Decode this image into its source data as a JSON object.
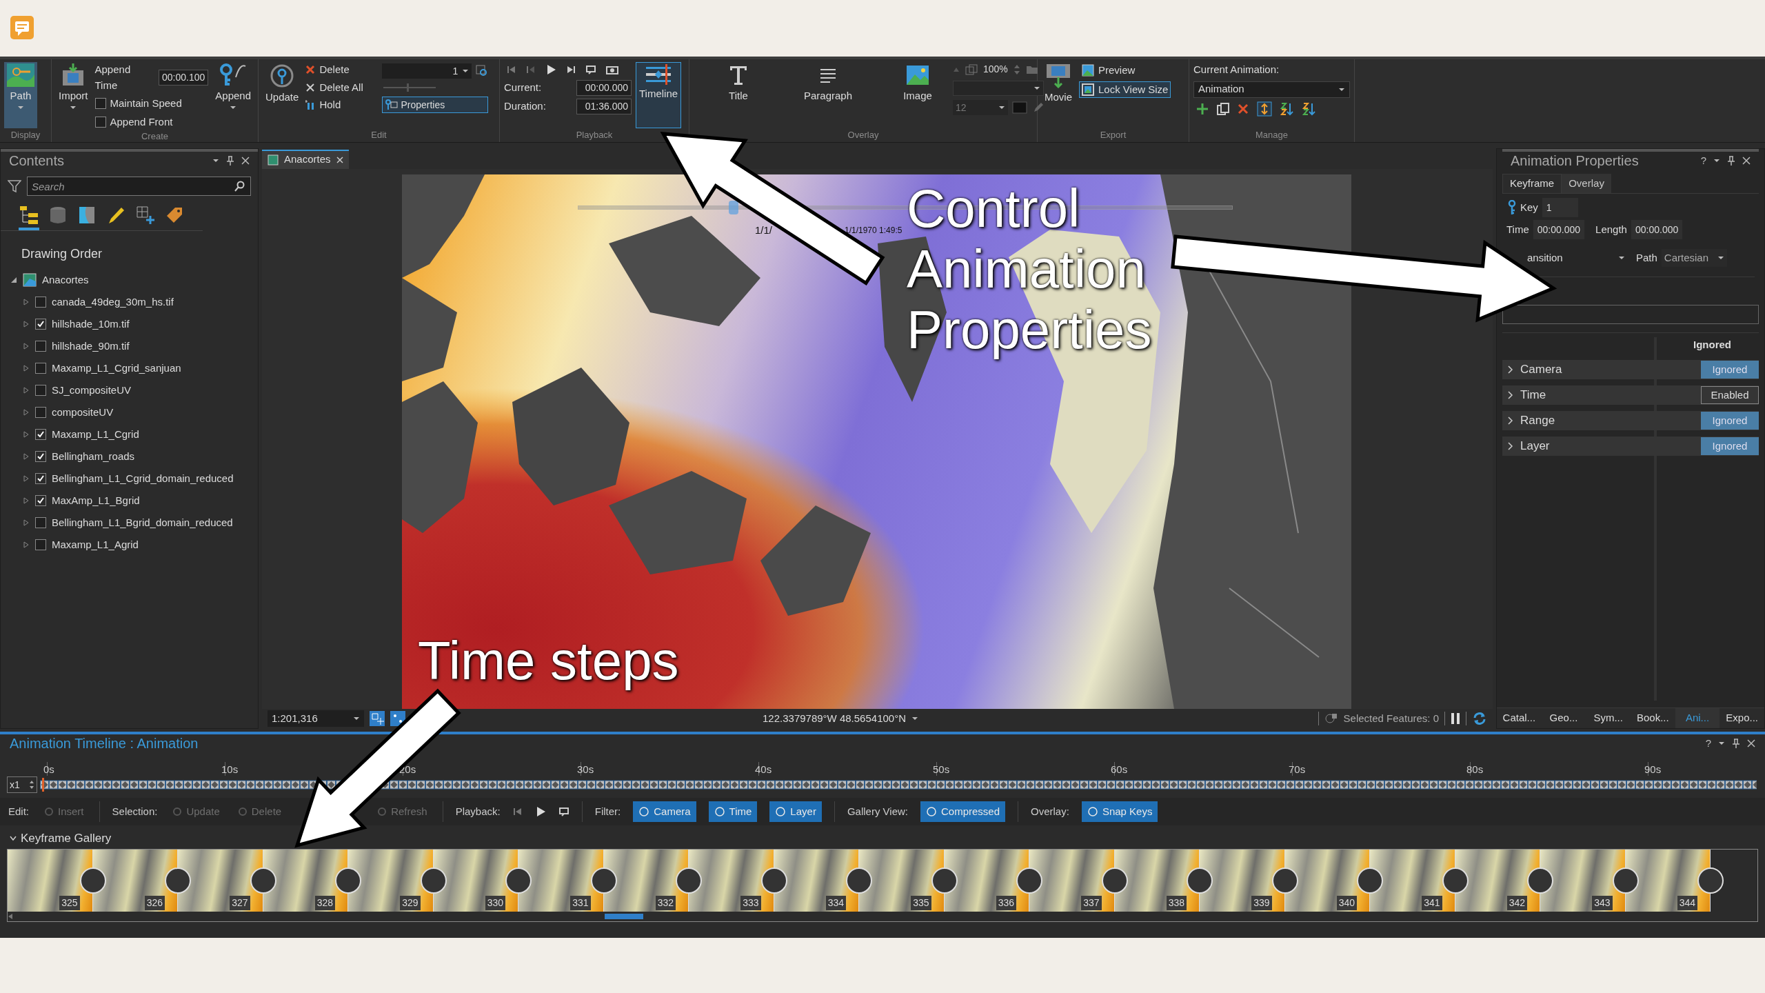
{
  "ribbon": {
    "display": {
      "label": "Display",
      "path_button": "Path"
    },
    "create": {
      "label": "Create",
      "import_button": "Import",
      "append_time_label": "Append Time",
      "append_time_value": "00:00.100",
      "append_button": "Append",
      "options": [
        {
          "label": "Maintain Speed",
          "checked": false
        },
        {
          "label": "Append Front",
          "checked": false
        }
      ]
    },
    "edit": {
      "label": "Edit",
      "update_button": "Update",
      "commands": [
        {
          "kind": "delete",
          "label": "Delete"
        },
        {
          "kind": "delete-all",
          "label": "Delete All"
        },
        {
          "kind": "hold",
          "label": "Hold"
        }
      ],
      "key_dropdown": "1",
      "properties_button": {
        "label": "Properties",
        "selected": true
      }
    },
    "playback": {
      "label": "Playback",
      "current_label": "Current:",
      "current_value": "00:00.000",
      "duration_label": "Duration:",
      "duration_value": "01:36.000",
      "timeline_button": {
        "label": "Timeline",
        "selected": true
      }
    },
    "overlay": {
      "label": "Overlay",
      "buttons": [
        {
          "kind": "title",
          "label": "Title"
        },
        {
          "kind": "paragraph",
          "label": "Paragraph"
        },
        {
          "kind": "image",
          "label": "Image"
        }
      ],
      "scale": "100%",
      "font_size": "12"
    },
    "export": {
      "label": "Export",
      "movie_button": "Movie",
      "options": [
        {
          "kind": "preview",
          "label": "Preview",
          "selected": false
        },
        {
          "kind": "lock",
          "label": "Lock View Size",
          "selected": true
        }
      ]
    },
    "manage": {
      "label": "Manage",
      "current_animation_label": "Current Animation:",
      "current_animation": "Animation"
    }
  },
  "contents": {
    "title": "Contents",
    "search_placeholder": "Search",
    "view_tabs": [
      {
        "kind": "drawing-order",
        "selected": true
      },
      {
        "kind": "data-source",
        "selected": false
      },
      {
        "kind": "selection",
        "selected": false
      },
      {
        "kind": "editing",
        "selected": false
      },
      {
        "kind": "snapping",
        "selected": false
      },
      {
        "kind": "labeling",
        "selected": false
      }
    ],
    "heading": "Drawing Order",
    "map": {
      "name": "Anacortes",
      "expanded": true,
      "children": [
        {
          "name": "canada_49deg_30m_hs.tif",
          "checked": false
        },
        {
          "name": "hillshade_10m.tif",
          "checked": true
        },
        {
          "name": "hillshade_90m.tif",
          "checked": false
        },
        {
          "name": "Maxamp_L1_Cgrid_sanjuan",
          "checked": false
        },
        {
          "name": "SJ_compositeUV",
          "checked": false
        },
        {
          "name": "compositeUV",
          "checked": false
        },
        {
          "name": "Maxamp_L1_Cgrid",
          "checked": true
        },
        {
          "name": "Bellingham_roads",
          "checked": true
        },
        {
          "name": "Bellingham_L1_Cgrid_domain_reduced",
          "checked": true
        },
        {
          "name": "MaxAmp_L1_Bgrid",
          "checked": true
        },
        {
          "name": "Bellingham_L1_Bgrid_domain_reduced",
          "checked": false
        },
        {
          "name": "Maxamp_L1_Agrid",
          "checked": false
        }
      ]
    }
  },
  "map_view": {
    "tab": "Anacortes",
    "time_slider": {
      "level": 0.23
    },
    "time_labels": [
      "1/1/",
      "1/1/1970 1:49:5"
    ],
    "scale": "1:201,316",
    "coordinates": "122.3379789°W 48.5654100°N",
    "selected_features": "Selected Features: 0"
  },
  "animation_properties": {
    "title": "Animation Properties",
    "help_button": "?",
    "tabs": [
      {
        "label": "Keyframe",
        "selected": true
      },
      {
        "label": "Overlay",
        "selected": false
      }
    ],
    "key_label": "Key",
    "key_value": "1",
    "time_label": "Time",
    "time_value": "00:00.000",
    "length_label": "Length",
    "length_value": "00:00.000",
    "transition_label": "ansition",
    "path_label": "Path",
    "path_value": "Cartesian",
    "column_header": "Ignored",
    "rows": [
      {
        "name": "Camera",
        "status": "Ignored",
        "highlighted": true
      },
      {
        "name": "Time",
        "status": "Enabled",
        "highlighted": false
      },
      {
        "name": "Range",
        "status": "Ignored",
        "highlighted": true
      },
      {
        "name": "Layer",
        "status": "Ignored",
        "highlighted": true
      }
    ]
  },
  "dock_tabs": [
    {
      "label": "Catal...",
      "selected": false
    },
    {
      "label": "Geo...",
      "selected": false
    },
    {
      "label": "Sym...",
      "selected": false
    },
    {
      "label": "Book...",
      "selected": false
    },
    {
      "label": "Ani...",
      "selected": true
    },
    {
      "label": "Expo...",
      "selected": false
    }
  ],
  "timeline": {
    "title": "Animation Timeline : Animation",
    "help_button": "?",
    "speed": "x1",
    "ticks": [
      "0s",
      "10s",
      "20s",
      "30s",
      "40s",
      "50s",
      "60s",
      "70s",
      "80s",
      "90s"
    ],
    "toolbar": [
      {
        "kind": "label",
        "text": "Edit:"
      },
      {
        "kind": "command",
        "text": "Insert",
        "disabled": true
      },
      {
        "kind": "separator"
      },
      {
        "kind": "label",
        "text": "Selection:"
      },
      {
        "kind": "command",
        "text": "Update",
        "disabled": true
      },
      {
        "kind": "command",
        "text": "Delete",
        "disabled": true
      },
      {
        "kind": "gap"
      },
      {
        "kind": "command",
        "text": "Refresh",
        "disabled": true
      },
      {
        "kind": "separator"
      },
      {
        "kind": "label",
        "text": "Playback:"
      },
      {
        "kind": "playback"
      },
      {
        "kind": "separator"
      },
      {
        "kind": "label",
        "text": "Filter:"
      },
      {
        "kind": "toggle",
        "text": "Camera",
        "on": true
      },
      {
        "kind": "toggle",
        "text": "Time",
        "on": true
      },
      {
        "kind": "toggle",
        "text": "Layer",
        "on": true
      },
      {
        "kind": "separator"
      },
      {
        "kind": "label",
        "text": "Gallery View:"
      },
      {
        "kind": "toggle",
        "text": "Compressed",
        "on": true
      },
      {
        "kind": "separator"
      },
      {
        "kind": "label",
        "text": "Overlay:"
      },
      {
        "kind": "toggle",
        "text": "Snap Keys",
        "on": true
      }
    ],
    "gallery": {
      "title": "Keyframe Gallery",
      "expanded": true,
      "keyframes": [
        "325",
        "326",
        "327",
        "328",
        "329",
        "330",
        "331",
        "332",
        "333",
        "334",
        "335",
        "336",
        "337",
        "338",
        "339",
        "340",
        "341",
        "342",
        "343",
        "344"
      ]
    }
  },
  "annotations": [
    {
      "text": "Control Animation Properties"
    },
    {
      "text": "Time steps"
    }
  ]
}
